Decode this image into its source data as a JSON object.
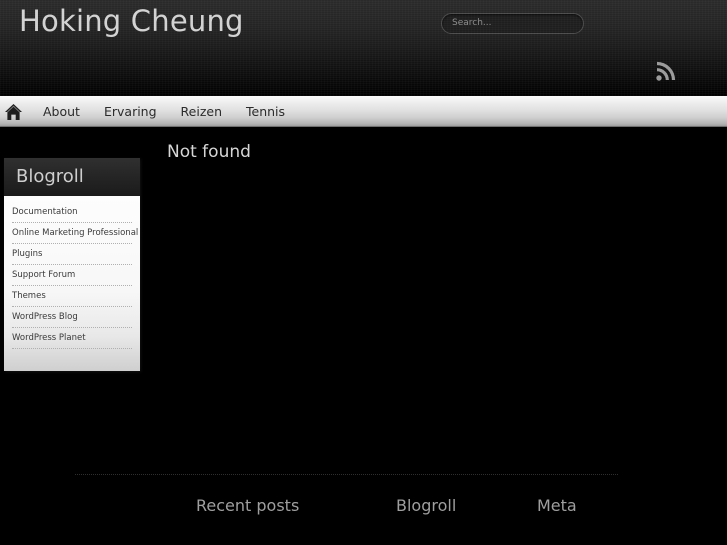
{
  "header": {
    "site_title": "Hoking Cheung",
    "search": {
      "placeholder": "Search...",
      "value": ""
    },
    "rss_icon": "rss-feed-icon"
  },
  "nav": {
    "home_icon": "home-icon",
    "items": [
      {
        "label": "About"
      },
      {
        "label": "Ervaring"
      },
      {
        "label": "Reizen"
      },
      {
        "label": "Tennis"
      }
    ]
  },
  "main": {
    "page_title": "Not found"
  },
  "sidebar": {
    "widgets": [
      {
        "title": "Blogroll",
        "links": [
          {
            "label": "Documentation"
          },
          {
            "label": "Online Marketing Professional"
          },
          {
            "label": "Plugins"
          },
          {
            "label": "Support Forum"
          },
          {
            "label": "Themes"
          },
          {
            "label": "WordPress Blog"
          },
          {
            "label": "WordPress Planet"
          }
        ]
      }
    ]
  },
  "footer": {
    "columns": [
      {
        "title": "Recent posts"
      },
      {
        "title": "Blogroll"
      },
      {
        "title": "Meta"
      }
    ]
  },
  "colors": {
    "page_background": "#000000",
    "header_gradient_top": "#2a2a2a",
    "header_gradient_bottom": "#000000",
    "nav_gradient_top": "#fbfbfb",
    "nav_gradient_bottom": "#9f9f9f",
    "title_text": "#d2d2d2",
    "widget_header": "#262626",
    "widget_body": "#f7f7f7",
    "footer_text": "#9f9f9f"
  }
}
